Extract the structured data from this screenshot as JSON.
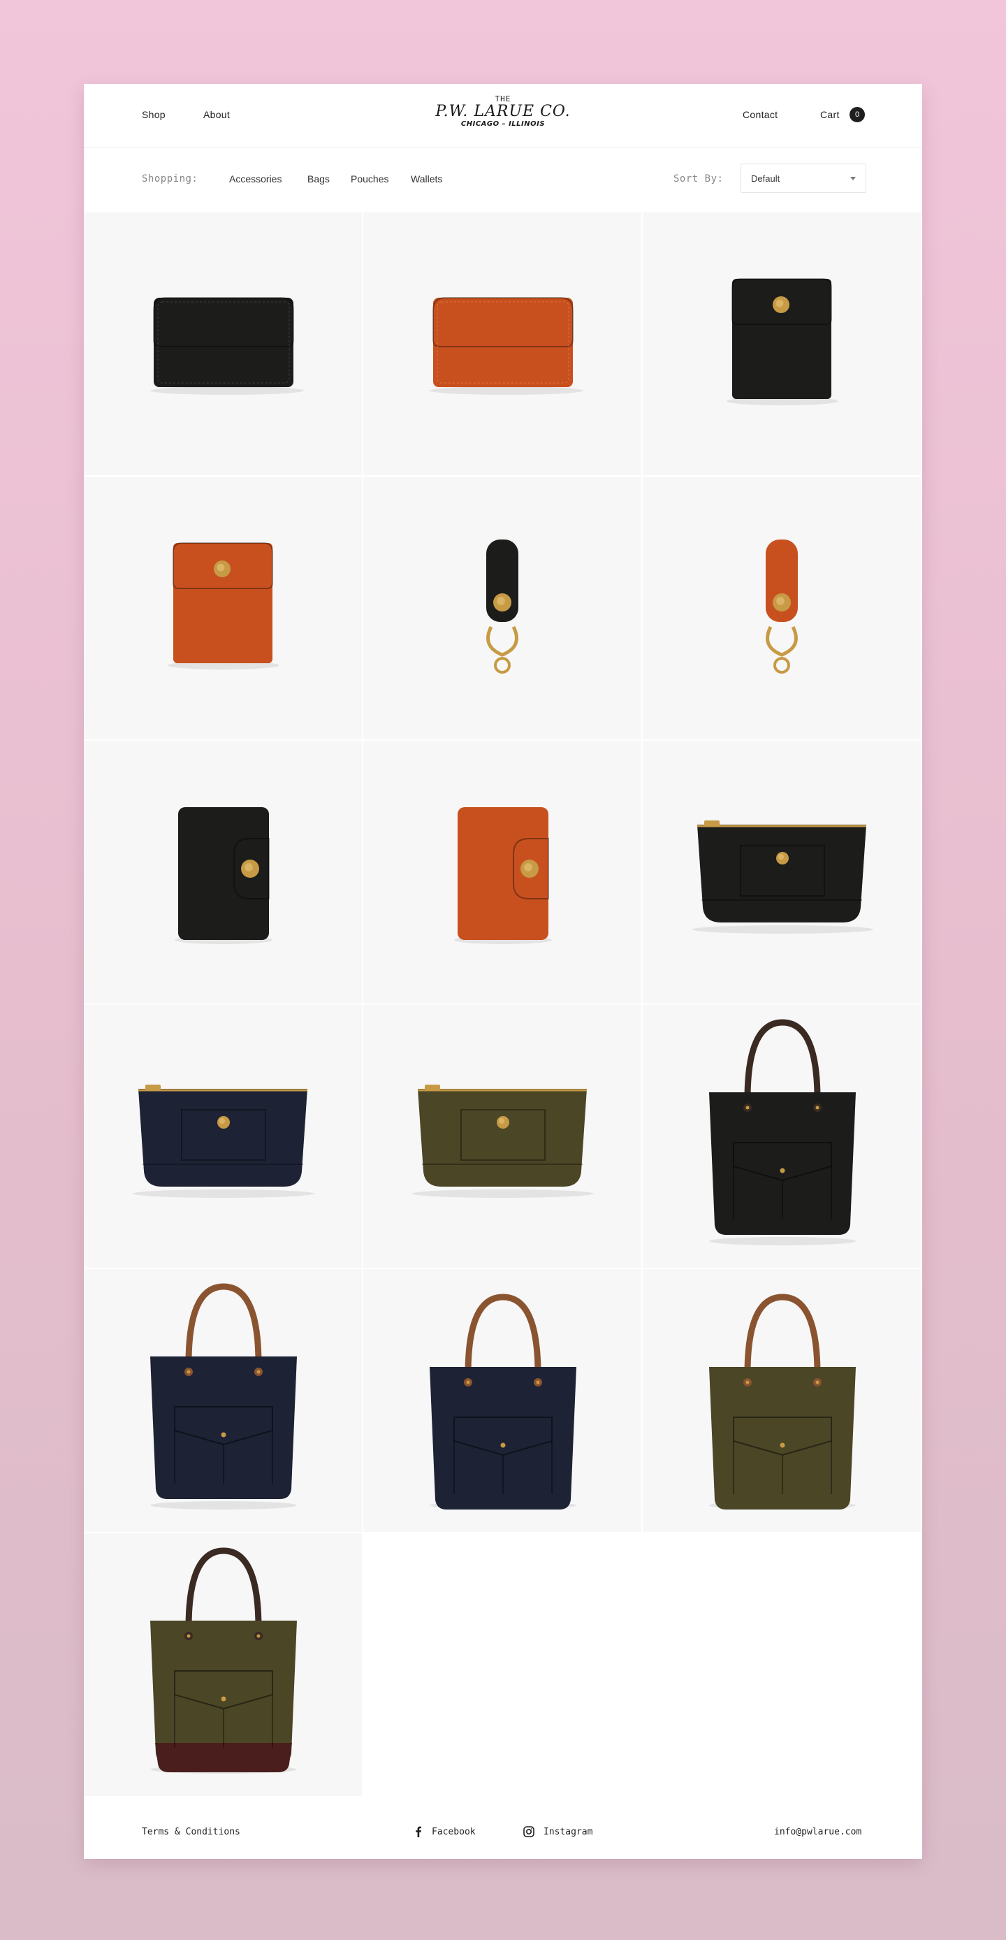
{
  "nav": {
    "shop": "Shop",
    "about": "About",
    "contact": "Contact",
    "cart": "Cart",
    "cart_count": "0"
  },
  "logo": {
    "the": "THE",
    "name": "P.W. LARUE CO.",
    "city": "CHICAGO – ILLINOIS"
  },
  "filter": {
    "label": "Shopping:",
    "categories": [
      "Accessories",
      "Bags",
      "Pouches",
      "Wallets"
    ],
    "sort_label": "Sort By:",
    "sort_value": "Default"
  },
  "products": [
    {
      "kind": "wallet-flat",
      "color": "black"
    },
    {
      "kind": "wallet-flat",
      "color": "tan"
    },
    {
      "kind": "wallet-tall",
      "color": "black"
    },
    {
      "kind": "wallet-tall",
      "color": "tan"
    },
    {
      "kind": "keyfob",
      "color": "black"
    },
    {
      "kind": "keyfob",
      "color": "tan"
    },
    {
      "kind": "card-case",
      "color": "black"
    },
    {
      "kind": "card-case",
      "color": "tan"
    },
    {
      "kind": "pouch",
      "color": "black"
    },
    {
      "kind": "pouch",
      "color": "navy"
    },
    {
      "kind": "pouch",
      "color": "olive"
    },
    {
      "kind": "tote",
      "color": "black"
    },
    {
      "kind": "tote",
      "color": "navy"
    },
    {
      "kind": "tote-small",
      "color": "navy"
    },
    {
      "kind": "tote-small",
      "color": "olive"
    },
    {
      "kind": "tote",
      "color": "olive-maroon"
    }
  ],
  "footer": {
    "terms": "Terms & Conditions",
    "facebook": "Facebook",
    "instagram": "Instagram",
    "email": "info@pwlarue.com"
  },
  "colors": {
    "black": "#1c1c1a",
    "tan": "#c8501f",
    "navy": "#1d2234",
    "olive": "#4a4626",
    "brass": "#c79a45",
    "handle_brown": "#8a5430",
    "handle_dark": "#3a2a22",
    "maroon": "#4a1e1c"
  }
}
